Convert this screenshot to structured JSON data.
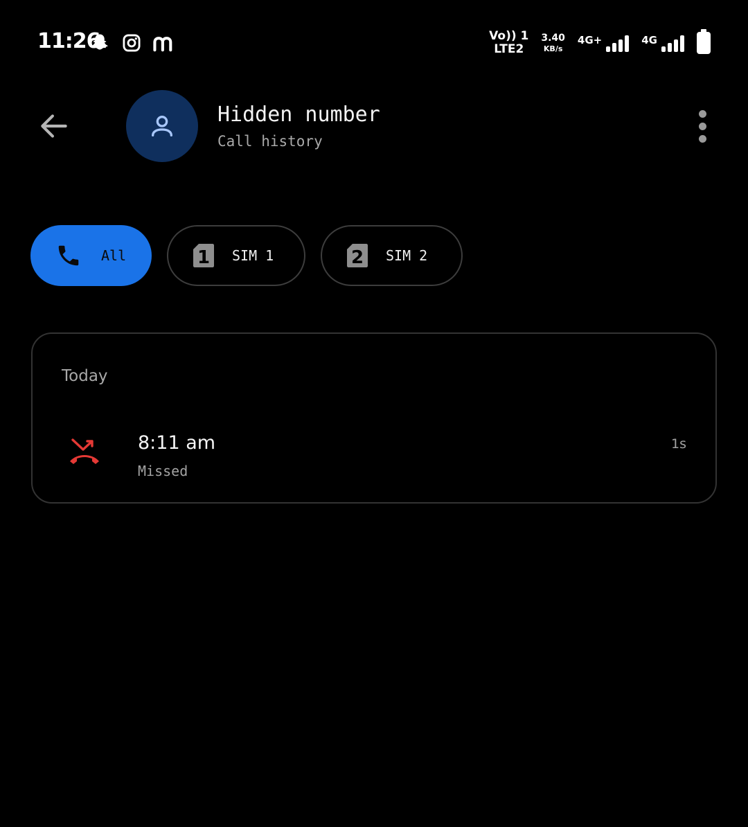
{
  "status_bar": {
    "time": "11:26",
    "app_icons": [
      "snapchat-icon",
      "instagram-icon",
      "m-app-icon"
    ],
    "volte_top": "Vo)) 1",
    "volte_bottom": "LTE2",
    "speed_value": "3.40",
    "speed_unit": "KB/s",
    "sim1_network": "4G+",
    "sim2_network": "4G"
  },
  "header": {
    "back_icon": "arrow-left-icon",
    "avatar_icon": "person-icon",
    "contact_name": "Hidden number",
    "subtitle": "Call history",
    "more_icon": "more-vert-icon"
  },
  "filters": {
    "all_label": "All",
    "sim1_label": "SIM 1",
    "sim1_number": "1",
    "sim2_label": "SIM 2",
    "sim2_number": "2",
    "selected": "All"
  },
  "history": {
    "section_label": "Today",
    "calls": [
      {
        "time": "8:11 am",
        "status": "Missed",
        "duration": "1s",
        "icon": "missed-call-icon"
      }
    ]
  },
  "colors": {
    "background": "#000000",
    "accent": "#1a73e8",
    "avatar_bg": "#0f2f5d",
    "avatar_fg": "#a8c7fa",
    "missed": "#e53935",
    "border": "#333333",
    "secondary_text": "#a8a8a8"
  }
}
